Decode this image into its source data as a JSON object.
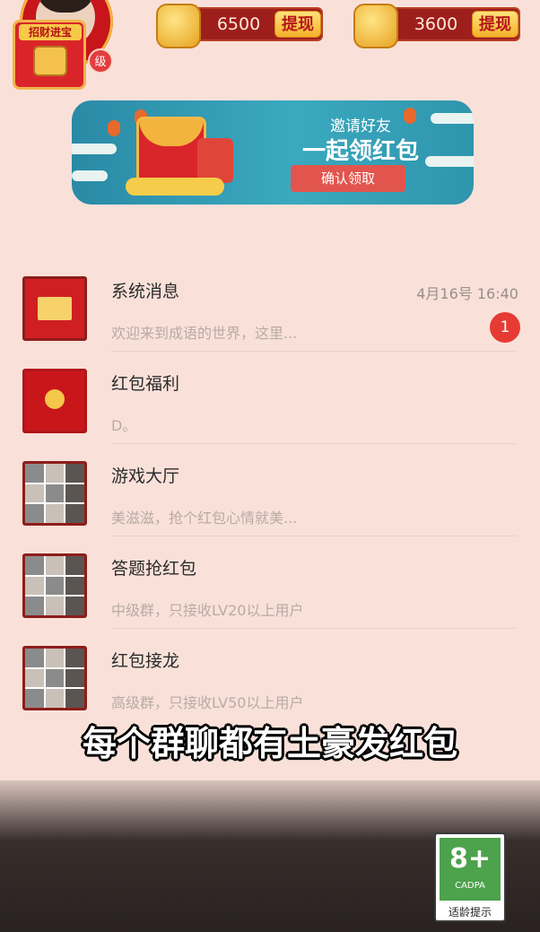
{
  "header": {
    "level_title": "招财进宝",
    "level_suffix": "级",
    "coins": [
      {
        "value": "6500",
        "action": "提现"
      },
      {
        "value": "3600",
        "action": "提现"
      }
    ]
  },
  "banner": {
    "line1": "邀请好友",
    "line2": "一起领红包",
    "button": "确认领取"
  },
  "chats": [
    {
      "title": "系统消息",
      "subtitle": "欢迎来到成语的世界，这里...",
      "time": "4月16号  16:40",
      "badge": "1",
      "icon": "mail-icon"
    },
    {
      "title": "红包福利",
      "subtitle": "D。",
      "time": "",
      "badge": "",
      "icon": "red-envelope-icon"
    },
    {
      "title": "游戏大厅",
      "subtitle": "美滋滋，抢个红包心情就美...",
      "time": "",
      "badge": "",
      "icon": "group-avatar-icon"
    },
    {
      "title": "答题抢红包",
      "subtitle": "中级群，只接收LV20以上用户",
      "time": "",
      "badge": "",
      "icon": "group-avatar-icon"
    },
    {
      "title": "红包接龙",
      "subtitle": "高级群，只接收LV50以上用户",
      "time": "",
      "badge": "",
      "icon": "group-avatar-icon"
    }
  ],
  "caption": "每个群聊都有土豪发红包",
  "age_rating": {
    "number": "8+",
    "org": "CADPA",
    "label": "适龄提示"
  }
}
